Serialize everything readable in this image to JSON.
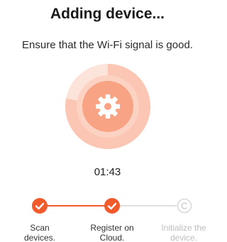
{
  "header": {
    "title": "Adding device...",
    "subtitle": "Ensure that the Wi-Fi signal is good."
  },
  "progress": {
    "icon": "gear-icon",
    "timer": "01:43",
    "ring_fraction": 0.78
  },
  "steps": [
    {
      "label_line1": "Scan",
      "label_line2": "devices.",
      "status": "done",
      "icon": "check-icon"
    },
    {
      "label_line1": "Register on",
      "label_line2": "Cloud.",
      "status": "done",
      "icon": "check-icon"
    },
    {
      "label_line1": "Initialize the",
      "label_line2": "device.",
      "status": "pending",
      "icon": "c-icon"
    }
  ],
  "colors": {
    "accent": "#f15a2b",
    "ring_inner": "#f8a384",
    "ring_outer_done": "#fbc6b3",
    "ring_outer_track": "#fde4da",
    "pending": "#d9d9d9"
  }
}
